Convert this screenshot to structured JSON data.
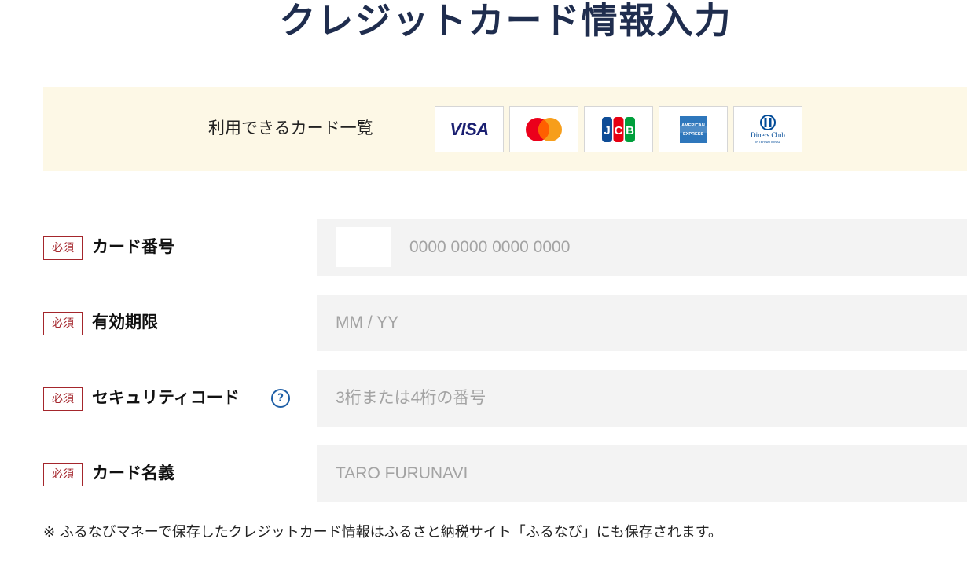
{
  "page": {
    "title": "クレジットカード情報入力"
  },
  "brands": {
    "label": "利用できるカード一覧",
    "items": [
      {
        "name": "VISA",
        "icon": "visa-logo"
      },
      {
        "name": "Mastercard",
        "icon": "mastercard-logo"
      },
      {
        "name": "JCB",
        "icon": "jcb-logo"
      },
      {
        "name": "American Express",
        "icon": "amex-logo"
      },
      {
        "name": "Diners Club",
        "icon": "diners-club-logo"
      }
    ],
    "visa_text": "VISA",
    "jcb_text": "JCB",
    "amex_text": "AMERICAN EXPRESS",
    "diners_text": "Diners Club",
    "diners_sub": "INTERNATIONAL"
  },
  "form": {
    "required_label": "必須",
    "card_number": {
      "label": "カード番号",
      "placeholder": "0000 0000 0000 0000",
      "value": ""
    },
    "expiry": {
      "label": "有効期限",
      "placeholder": "MM / YY",
      "value": ""
    },
    "security_code": {
      "label": "セキュリティコード",
      "placeholder": "3桁または4桁の番号",
      "value": "",
      "help_icon": "question-circle-icon",
      "help_glyph": "?"
    },
    "card_holder": {
      "label": "カード名義",
      "placeholder": "TARO FURUNAVI",
      "value": ""
    }
  },
  "note": "※ ふるなびマネーで保存したクレジットカード情報はふるさと納税サイト「ふるなび」にも保存されます。",
  "colors": {
    "title": "#1f2d4e",
    "brand_bg": "#fdf8e6",
    "required": "#a4262c",
    "field_bg": "#f3f3f3",
    "help": "#1f5fa6",
    "visa": "#1a1f71",
    "mastercard_red": "#eb001b",
    "mastercard_yellow": "#f79e1b",
    "amex": "#2e77bc"
  }
}
